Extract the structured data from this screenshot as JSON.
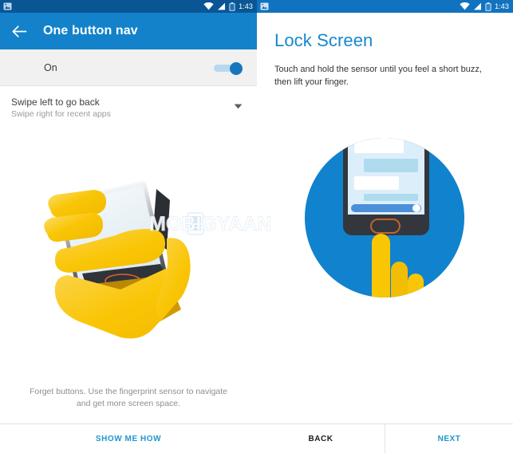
{
  "status_bar": {
    "time": "1:43",
    "left_icons": [
      "photo-icon"
    ],
    "right_icons": [
      "wifi-icon",
      "signal-icon",
      "battery-icon"
    ]
  },
  "left_screen": {
    "appbar": {
      "back_icon": "arrow-left-icon",
      "title": "One button nav"
    },
    "toggle_row": {
      "label": "On",
      "state": "on"
    },
    "option_row": {
      "title": "Swipe left to go back",
      "subtitle": "Swipe right for recent apps",
      "chevron_icon": "chevron-down-icon"
    },
    "illustration": "hand-holding-phone-illustration",
    "caption": "Forget buttons. Use the fingerprint sensor to navigate and get more screen space.",
    "action_label": "SHOW ME HOW"
  },
  "right_screen": {
    "title": "Lock Screen",
    "description": "Touch and hold the sensor until you feel a short buzz, then lift your finger.",
    "illustration": "finger-touching-phone-home-button-illustration",
    "back_label": "BACK",
    "next_label": "NEXT"
  },
  "watermark": {
    "text": "MOBIGYAAN"
  },
  "colors": {
    "status_bar_dark": "#0a5695",
    "status_bar_light": "#1173bf",
    "appbar_blue": "#1482ca",
    "accent_blue": "#2196cf",
    "title_blue": "#1787cd",
    "illustration_blue": "#1182cd",
    "illustration_yellow": "#f9c606",
    "toggle_on": "#1976bd"
  }
}
